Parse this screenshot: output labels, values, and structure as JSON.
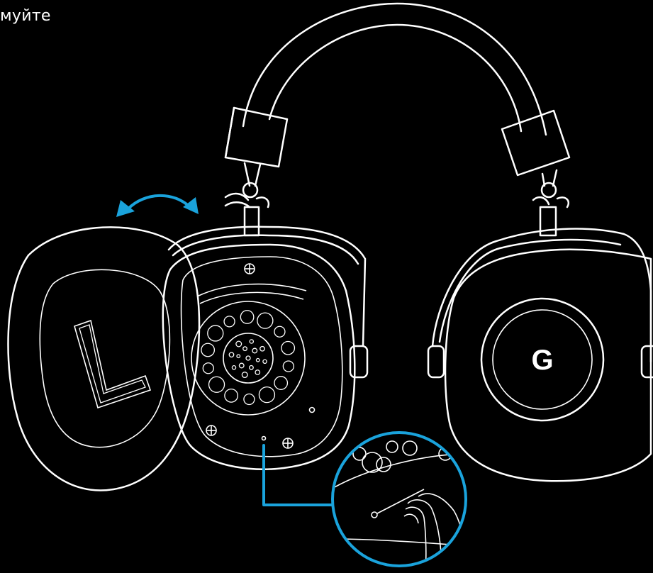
{
  "caption": "муйте",
  "earcup_letter": "L",
  "brand_mark": "G",
  "colors": {
    "background": "#000000",
    "line": "#ffffff",
    "accent": "#1aa3dc"
  },
  "icons": [
    "double-arrow-icon",
    "g-logo-icon",
    "screw-icon",
    "zoom-callout-icon",
    "hand-icon"
  ]
}
